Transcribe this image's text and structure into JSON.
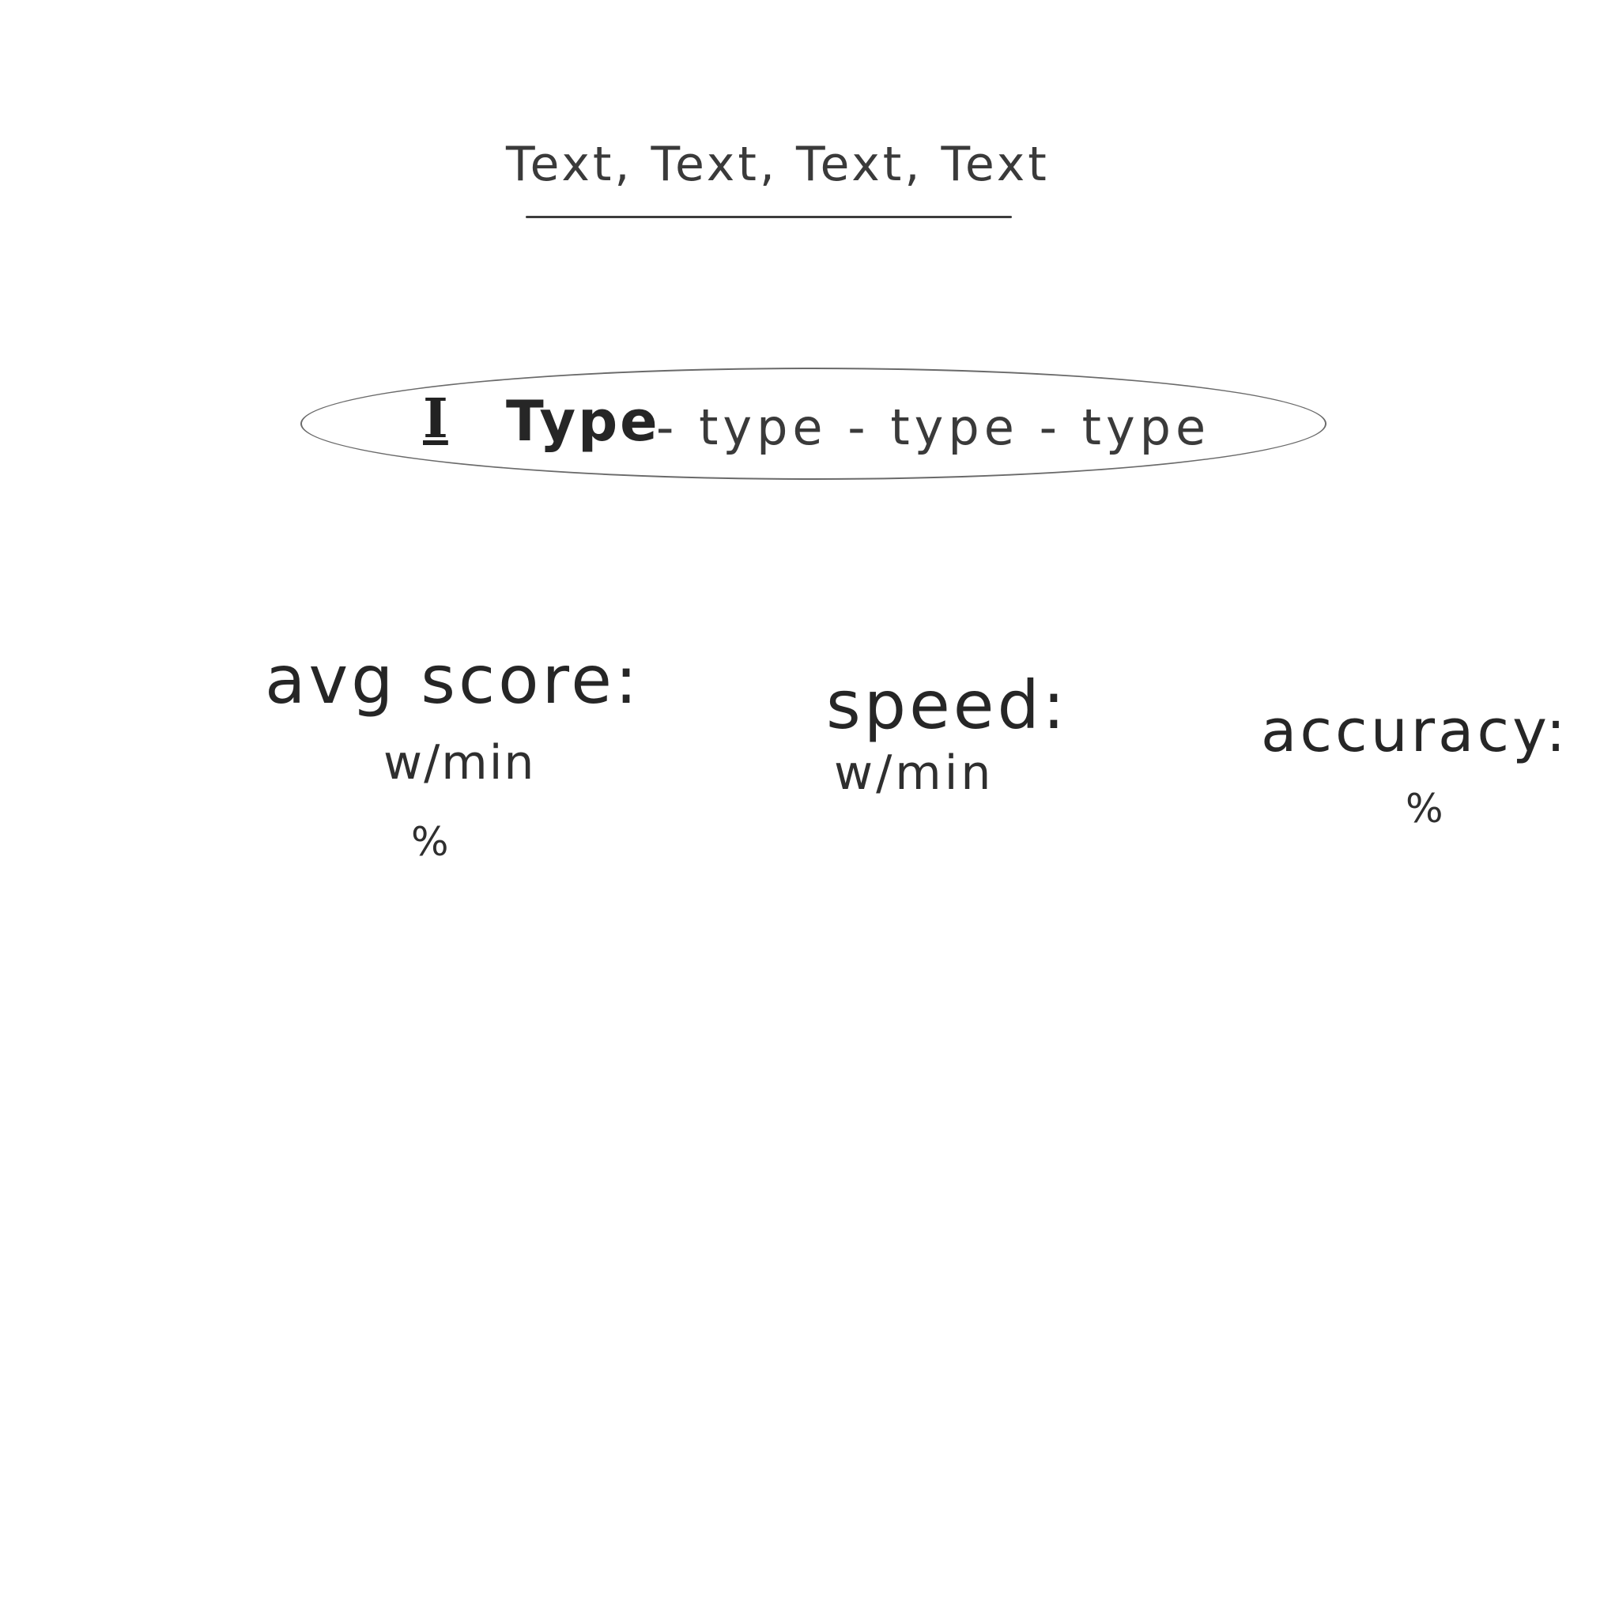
{
  "prompt": {
    "text": "Text, Text, Text, Text"
  },
  "typing_area": {
    "caret_glyph": "I",
    "typed_word": "Type",
    "upcoming_words": "- type - type - type"
  },
  "stats": {
    "avg_score": {
      "label": "avg score:",
      "speed_unit": "w/min",
      "accuracy_unit": "%"
    },
    "speed": {
      "label": "speed:",
      "unit": "w/min"
    },
    "accuracy": {
      "label": "accuracy:",
      "unit": "%"
    }
  }
}
